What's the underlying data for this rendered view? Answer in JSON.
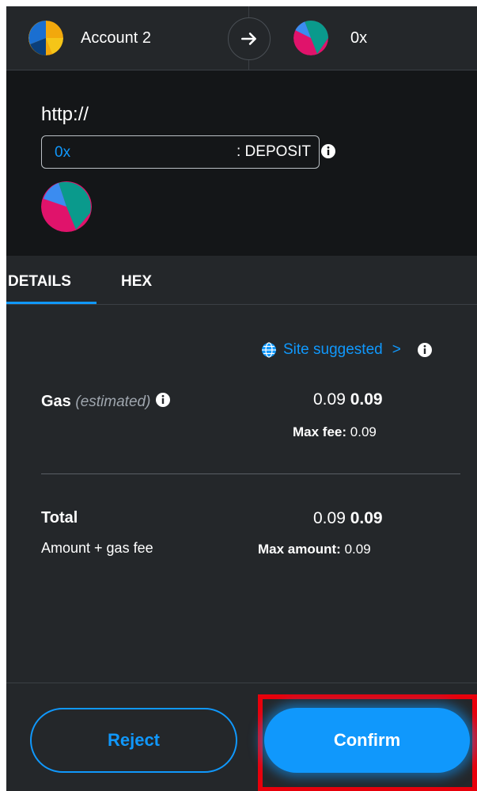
{
  "header": {
    "from_account": "Account 2",
    "to_account": "0x"
  },
  "site": {
    "origin": "http://",
    "method_address": "0x",
    "method_name": ": DEPOSIT"
  },
  "tabs": [
    {
      "label": "DETAILS",
      "active": true
    },
    {
      "label": "HEX",
      "active": false
    }
  ],
  "gas_fee_source": {
    "label": "Site suggested",
    "chevron": ">"
  },
  "gas": {
    "label": "Gas",
    "estimated": "(estimated)",
    "value_plain": "0.09",
    "value_bold": "0.09",
    "max_fee_label": "Max fee:",
    "max_fee_value": "0.09"
  },
  "total": {
    "label": "Total",
    "sub_label": "Amount + gas fee",
    "value_plain": "0.09",
    "value_bold": "0.09",
    "max_amount_label": "Max amount:",
    "max_amount_value": "0.09"
  },
  "footer": {
    "reject_label": "Reject",
    "confirm_label": "Confirm"
  },
  "colors": {
    "accent": "#1098fc",
    "background": "#24272a",
    "panel_dark": "#141618",
    "highlight": "#e8000b"
  }
}
